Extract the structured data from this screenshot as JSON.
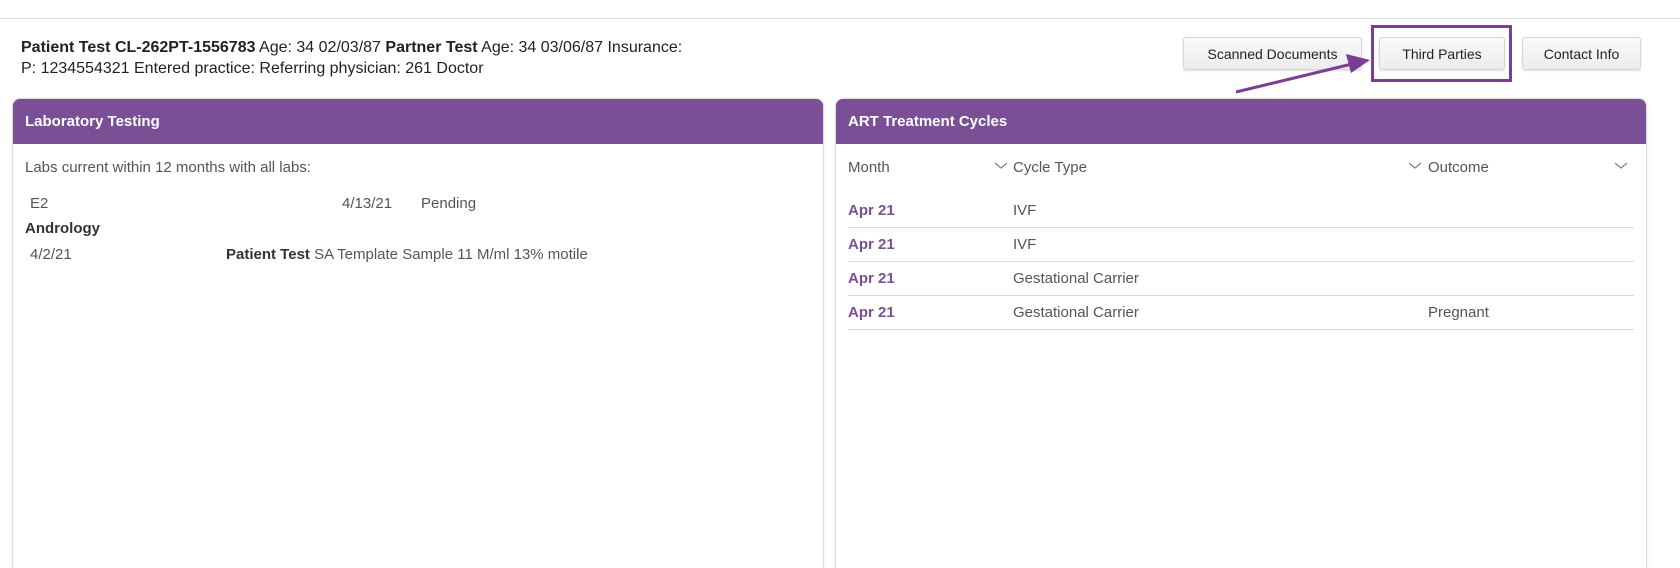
{
  "header": {
    "patient_name": "Patient Test",
    "patient_id": "CL-262PT-1556783",
    "patient_age_label": "Age: 34",
    "patient_dob": "02/03/87",
    "partner_name": "Partner Test",
    "partner_age_label": "Age: 34",
    "partner_dob": "03/06/87",
    "insurance_label": "Insurance:",
    "phone_label": "P: 1234554321",
    "entered_practice_label": "Entered practice:",
    "referring_label": "Referring physician: 261 Doctor"
  },
  "buttons": {
    "scanned_documents": "Scanned Documents",
    "third_parties": "Third Parties",
    "contact_info": "Contact Info"
  },
  "lab_panel": {
    "title": "Laboratory Testing",
    "summary": "Labs current within 12 months with all labs:",
    "e2": {
      "name": "E2",
      "date": "4/13/21",
      "status": "Pending"
    },
    "andrology_heading": "Andrology",
    "andrology": {
      "date": "4/2/21",
      "person": "Patient Test",
      "detail": "SA Template Sample 11 M/ml 13% motile"
    }
  },
  "art_panel": {
    "title": "ART Treatment Cycles",
    "columns": {
      "month": "Month",
      "cycle_type": "Cycle Type",
      "outcome": "Outcome"
    },
    "rows": [
      {
        "month": "Apr 21",
        "cycle_type": "IVF",
        "outcome": ""
      },
      {
        "month": "Apr 21",
        "cycle_type": "IVF",
        "outcome": ""
      },
      {
        "month": "Apr 21",
        "cycle_type": "Gestational Carrier",
        "outcome": ""
      },
      {
        "month": "Apr 21",
        "cycle_type": "Gestational Carrier",
        "outcome": "Pregnant"
      }
    ]
  },
  "colors": {
    "accent_purple": "#7a4f96",
    "annotation_purple": "#7a3f94"
  },
  "icons": {
    "column_sort": "chevron-down-icon",
    "annotation": "arrow-icon"
  }
}
